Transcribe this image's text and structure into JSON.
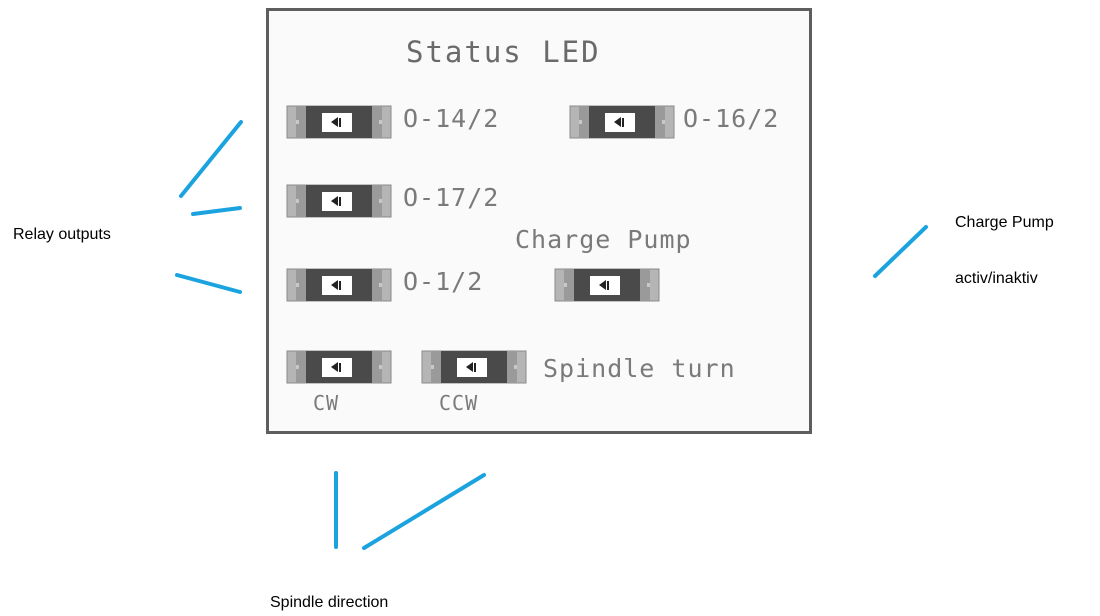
{
  "panel": {
    "title": "Status LED",
    "leds": [
      {
        "label": "O-14/2"
      },
      {
        "label": "O-16/2"
      },
      {
        "label": "O-17/2"
      },
      {
        "label": "O-1/2"
      },
      {
        "label": "Charge Pump"
      },
      {
        "label": "CW"
      },
      {
        "label": "CCW"
      }
    ],
    "spindle_label": "Spindle turn"
  },
  "annotations": {
    "relay": "Relay outputs",
    "charge_line1": "Charge Pump",
    "charge_line2": "activ/inaktiv",
    "spindle": "Spindle direction"
  },
  "colors": {
    "pointer_line": "#1aa3df",
    "led_body": "#4a4a4a",
    "led_pad": "#b5b5b5"
  }
}
